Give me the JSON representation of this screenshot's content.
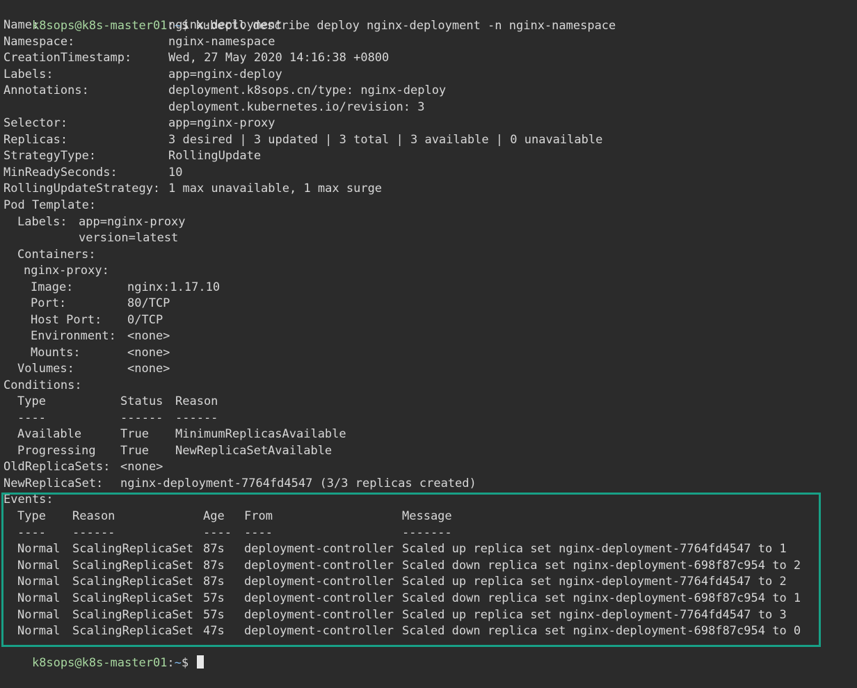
{
  "prompt": {
    "user_host": "k8sops@k8s-master01",
    "separator": ":",
    "path": "~",
    "symbol": "$",
    "command": "kubectl describe deploy nginx-deployment -n nginx-namespace"
  },
  "fields": [
    {
      "key": "Name:",
      "value": "nginx-deployment"
    },
    {
      "key": "Namespace:",
      "value": "nginx-namespace"
    },
    {
      "key": "CreationTimestamp:",
      "value": "Wed, 27 May 2020 14:16:38 +0800"
    },
    {
      "key": "Labels:",
      "value": "app=nginx-deploy"
    },
    {
      "key": "Annotations:",
      "value": "deployment.k8sops.cn/type: nginx-deploy"
    },
    {
      "key": "",
      "value": "deployment.kubernetes.io/revision: 3"
    },
    {
      "key": "Selector:",
      "value": "app=nginx-proxy"
    },
    {
      "key": "Replicas:",
      "value": "3 desired | 3 updated | 3 total | 3 available | 0 unavailable"
    },
    {
      "key": "StrategyType:",
      "value": "RollingUpdate"
    },
    {
      "key": "MinReadySeconds:",
      "value": "10"
    },
    {
      "key": "RollingUpdateStrategy:",
      "value": "1 max unavailable, 1 max surge"
    }
  ],
  "pod_template": {
    "heading": "Pod Template:",
    "labels_key": "Labels:",
    "labels": [
      "app=nginx-proxy",
      "version=latest"
    ],
    "containers_heading": "Containers:",
    "container_name": "nginx-proxy:",
    "container_fields": [
      {
        "key": "Image:",
        "value": "nginx:1.17.10"
      },
      {
        "key": "Port:",
        "value": "80/TCP"
      },
      {
        "key": "Host Port:",
        "value": "0/TCP"
      },
      {
        "key": "Environment:",
        "value": "<none>"
      },
      {
        "key": "Mounts:",
        "value": "<none>"
      }
    ],
    "volumes_key": "Volumes:",
    "volumes_value": "<none>"
  },
  "conditions": {
    "heading": "Conditions:",
    "headers": [
      "Type",
      "Status",
      "Reason"
    ],
    "dashes": [
      "----",
      "------",
      "------"
    ],
    "rows": [
      [
        "Available",
        "True",
        "MinimumReplicasAvailable"
      ],
      [
        "Progressing",
        "True",
        "NewReplicaSetAvailable"
      ]
    ]
  },
  "old_replica_sets": {
    "key": "OldReplicaSets:",
    "value": "<none>"
  },
  "new_replica_set": {
    "key": "NewReplicaSet:",
    "value": "nginx-deployment-7764fd4547 (3/3 replicas created)"
  },
  "events": {
    "heading": "Events:",
    "headers": [
      "Type",
      "Reason",
      "Age",
      "From",
      "Message"
    ],
    "dashes": [
      "----",
      "------",
      "----",
      "----",
      "-------"
    ],
    "rows": [
      [
        "Normal",
        "ScalingReplicaSet",
        "87s",
        "deployment-controller",
        "Scaled up replica set nginx-deployment-7764fd4547 to 1"
      ],
      [
        "Normal",
        "ScalingReplicaSet",
        "87s",
        "deployment-controller",
        "Scaled down replica set nginx-deployment-698f87c954 to 2"
      ],
      [
        "Normal",
        "ScalingReplicaSet",
        "87s",
        "deployment-controller",
        "Scaled up replica set nginx-deployment-7764fd4547 to 2"
      ],
      [
        "Normal",
        "ScalingReplicaSet",
        "57s",
        "deployment-controller",
        "Scaled down replica set nginx-deployment-698f87c954 to 1"
      ],
      [
        "Normal",
        "ScalingReplicaSet",
        "57s",
        "deployment-controller",
        "Scaled up replica set nginx-deployment-7764fd4547 to 3"
      ],
      [
        "Normal",
        "ScalingReplicaSet",
        "47s",
        "deployment-controller",
        "Scaled down replica set nginx-deployment-698f87c954 to 0"
      ]
    ]
  },
  "colors": {
    "background": "#2b2b2b",
    "text": "#d7d7d7",
    "prompt_user": "#a8d8a0",
    "highlight_border": "#18a086"
  }
}
